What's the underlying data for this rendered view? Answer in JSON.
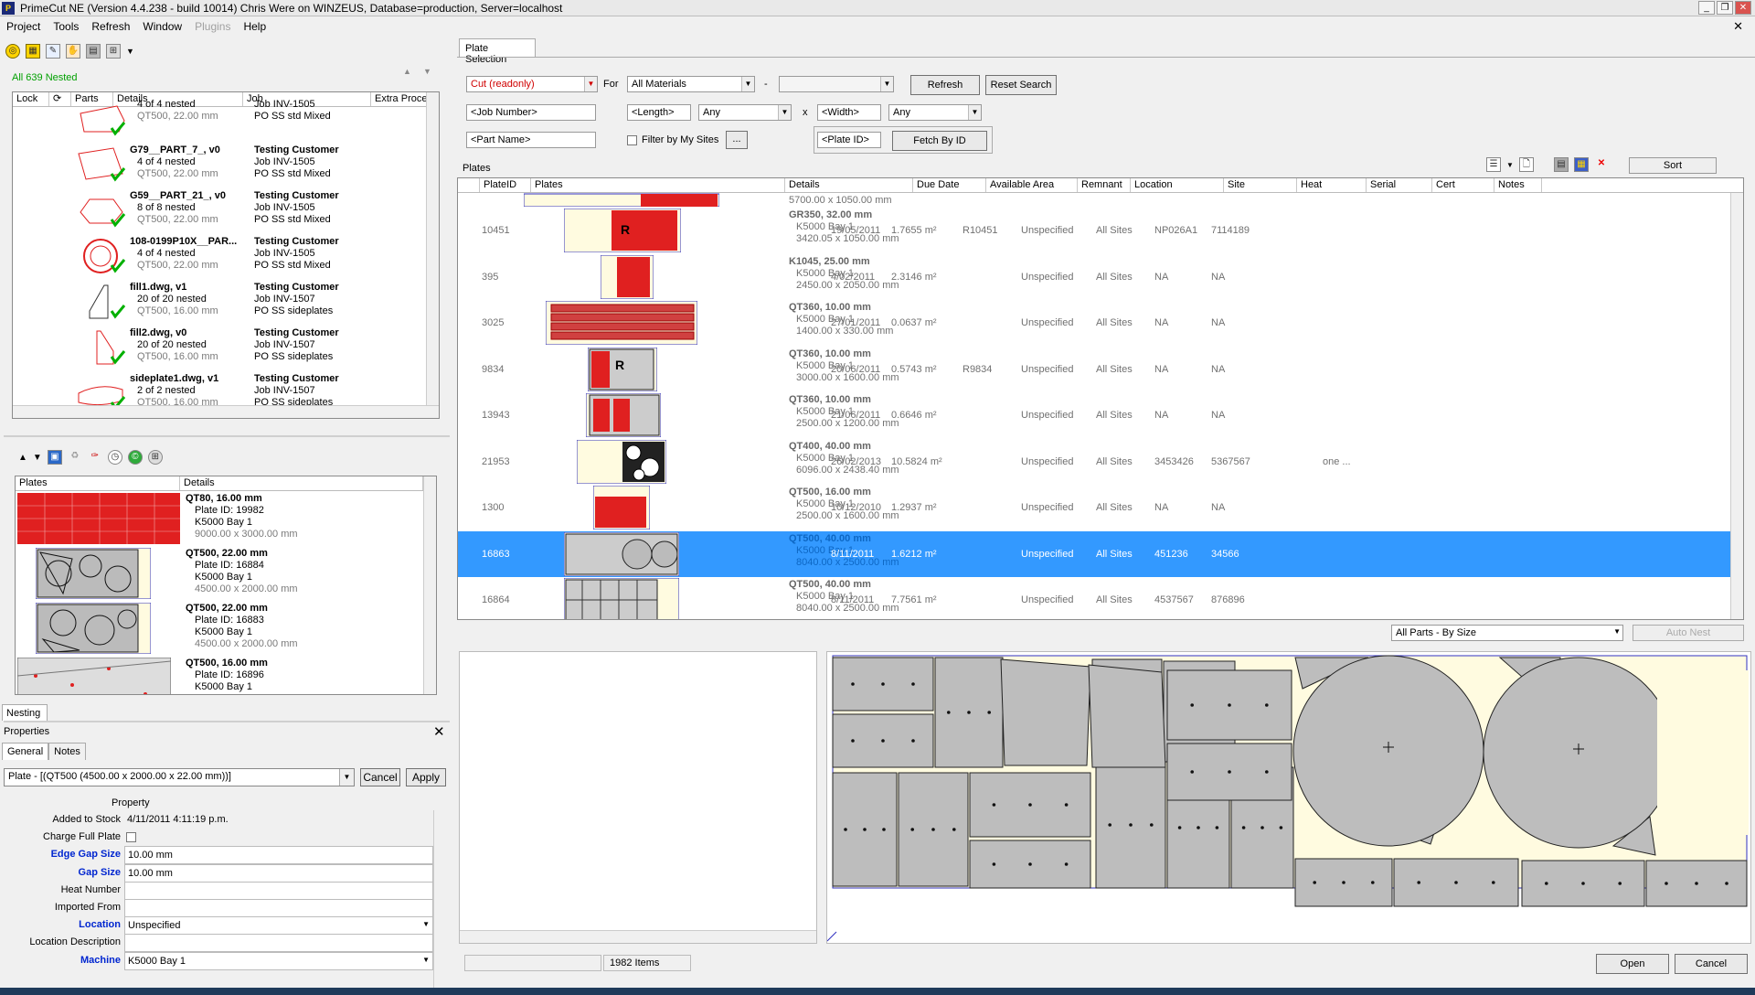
{
  "window": {
    "title": "PrimeCut NE (Version 4.4.238 - build 10014)  Chris Were on WINZEUS, Database=production, Server=localhost",
    "icon": "P",
    "controls": [
      "_",
      "❐",
      "✕"
    ]
  },
  "menu": {
    "items": [
      "Project",
      "Tools",
      "Refresh",
      "Window",
      "Plugins",
      "Help"
    ],
    "close": "✕"
  },
  "nested": {
    "summary": "All 639 Nested",
    "columns": [
      "Lock",
      "",
      "Parts",
      "Details",
      "Job",
      "Extra Proces"
    ],
    "rows": [
      {
        "name": "",
        "nested": "4 of 4 nested",
        "mat": "QT500, 22.00 mm",
        "customer": "",
        "job": "Job INV-1505",
        "po": "PO SS std Mixed"
      },
      {
        "name": "G79__PART_7_, v0",
        "nested": "4 of 4 nested",
        "mat": "QT500, 22.00 mm",
        "customer": "Testing Customer",
        "job": "Job INV-1505",
        "po": "PO SS std Mixed"
      },
      {
        "name": "G59__PART_21_, v0",
        "nested": "8 of 8 nested",
        "mat": "QT500, 22.00 mm",
        "customer": "Testing Customer",
        "job": "Job INV-1505",
        "po": "PO SS std Mixed"
      },
      {
        "name": "108-0199P10X__PAR...",
        "nested": "4 of 4 nested",
        "mat": "QT500, 22.00 mm",
        "customer": "Testing Customer",
        "job": "Job INV-1505",
        "po": "PO SS std Mixed"
      },
      {
        "name": "fill1.dwg, v1",
        "nested": "20 of 20 nested",
        "mat": "QT500, 16.00 mm",
        "customer": "Testing Customer",
        "job": "Job INV-1507",
        "po": "PO SS sideplates"
      },
      {
        "name": "fill2.dwg, v0",
        "nested": "20 of 20 nested",
        "mat": "QT500, 16.00 mm",
        "customer": "Testing Customer",
        "job": "Job INV-1507",
        "po": "PO SS sideplates"
      },
      {
        "name": "sideplate1.dwg, v1",
        "nested": "2 of 2 nested",
        "mat": "QT500, 16.00 mm",
        "customer": "Testing Customer",
        "job": "Job INV-1507",
        "po": "PO SS sideplates"
      }
    ]
  },
  "plates_panel": {
    "columns": [
      "Plates",
      "Details"
    ],
    "rows": [
      {
        "title": "QT80, 16.00 mm",
        "id": "Plate ID: 19982",
        "loc": "K5000 Bay 1",
        "size": "9000.00 x 3000.00 mm"
      },
      {
        "title": "QT500, 22.00 mm",
        "id": "Plate ID: 16884",
        "loc": "K5000 Bay 1",
        "size": "4500.00 x 2000.00 mm"
      },
      {
        "title": "QT500, 22.00 mm",
        "id": "Plate ID: 16883",
        "loc": "K5000 Bay 1",
        "size": "4500.00 x 2000.00 mm"
      },
      {
        "title": "QT500, 16.00 mm",
        "id": "Plate ID: 16896",
        "loc": "K5000 Bay 1",
        "size": ""
      }
    ]
  },
  "nesting_tab": "Nesting",
  "properties": {
    "header": "Properties",
    "tabs": [
      "General",
      "Notes"
    ],
    "selected": "Plate - [(QT500 (4500.00 x 2000.00 x 22.00 mm))]",
    "cancel": "Cancel",
    "apply": "Apply",
    "property_header": "Property",
    "fields": [
      {
        "label": "Added to Stock",
        "value": "4/11/2011 4:11:19 p.m.",
        "blue": false
      },
      {
        "label": "Charge Full Plate",
        "value": "",
        "blue": false
      },
      {
        "label": "Edge Gap Size",
        "value": "10.00 mm",
        "blue": true
      },
      {
        "label": "Gap Size",
        "value": "10.00 mm",
        "blue": true
      },
      {
        "label": "Heat Number",
        "value": "",
        "blue": false
      },
      {
        "label": "Imported From",
        "value": "",
        "blue": false
      },
      {
        "label": "Location",
        "value": "Unspecified",
        "blue": true
      },
      {
        "label": "Location Description",
        "value": "",
        "blue": false
      },
      {
        "label": "Machine",
        "value": "K5000 Bay 1",
        "blue": true
      }
    ]
  },
  "plate_selection": {
    "tab": "Plate Selection",
    "cut": "Cut (readonly)",
    "for": "For",
    "materials": "All Materials",
    "dash": "-",
    "refresh": "Refresh",
    "reset": "Reset Search",
    "job_number": "<Job Number>",
    "length": "<Length>",
    "any1": "Any",
    "x": "x",
    "width": "<Width>",
    "any2": "Any",
    "part_name": "<Part Name>",
    "filter_sites": "Filter by My Sites",
    "ellipsis": "...",
    "plate_id": "<Plate ID>",
    "fetch": "Fetch By ID",
    "plates_label": "Plates",
    "sort": "Sort"
  },
  "plates_table": {
    "columns": [
      "",
      "PlateID",
      "Plates",
      "Details",
      "Due Date",
      "Available Area",
      "Remnant",
      "Location",
      "Site",
      "Heat",
      "Serial",
      "Cert",
      "Notes"
    ],
    "partial_top": "5700.00 x 1050.00 mm",
    "rows": [
      {
        "id": "10451",
        "mat": "GR350, 32.00 mm",
        "bay": "K5000 Bay 1",
        "size": "3420.05 x 1050.00 mm",
        "due": "19/05/2011",
        "area": "1.7655 m²",
        "remnant": "R10451",
        "loc": "Unspecified",
        "site": "All Sites",
        "heat": "NP026A1",
        "serial": "7114189",
        "cert": "",
        "notes": ""
      },
      {
        "id": "395",
        "mat": "K1045, 25.00 mm",
        "bay": "K5000 Bay 1",
        "size": "2450.00 x 2050.00 mm",
        "due": "4/02/2011",
        "area": "2.3146 m²",
        "remnant": "",
        "loc": "Unspecified",
        "site": "All Sites",
        "heat": "NA",
        "serial": "NA",
        "cert": "",
        "notes": ""
      },
      {
        "id": "3025",
        "mat": "QT360, 10.00 mm",
        "bay": "K5000 Bay 1",
        "size": "1400.00 x 330.00 mm",
        "due": "27/01/2011",
        "area": "0.0637 m²",
        "remnant": "",
        "loc": "Unspecified",
        "site": "All Sites",
        "heat": "NA",
        "serial": "NA",
        "cert": "",
        "notes": ""
      },
      {
        "id": "9834",
        "mat": "QT360, 10.00 mm",
        "bay": "K5000 Bay 1",
        "size": "3000.00 x 1600.00 mm",
        "due": "20/06/2011",
        "area": "0.5743 m²",
        "remnant": "R9834",
        "loc": "Unspecified",
        "site": "All Sites",
        "heat": "NA",
        "serial": "NA",
        "cert": "",
        "notes": ""
      },
      {
        "id": "13943",
        "mat": "QT360, 10.00 mm",
        "bay": "K5000 Bay 1",
        "size": "2500.00 x 1200.00 mm",
        "due": "21/06/2011",
        "area": "0.6646 m²",
        "remnant": "",
        "loc": "Unspecified",
        "site": "All Sites",
        "heat": "NA",
        "serial": "NA",
        "cert": "",
        "notes": ""
      },
      {
        "id": "21953",
        "mat": "QT400, 40.00 mm",
        "bay": "K5000 Bay 1",
        "size": "6096.00 x 2438.40 mm",
        "due": "26/02/2013",
        "area": "10.5824 m²",
        "remnant": "",
        "loc": "Unspecified",
        "site": "All Sites",
        "heat": "3453426",
        "serial": "5367567",
        "cert": "",
        "notes": "one ..."
      },
      {
        "id": "1300",
        "mat": "QT500, 16.00 mm",
        "bay": "K5000 Bay 1",
        "size": "2500.00 x 1600.00 mm",
        "due": "10/12/2010",
        "area": "1.2937 m²",
        "remnant": "",
        "loc": "Unspecified",
        "site": "All Sites",
        "heat": "NA",
        "serial": "NA",
        "cert": "",
        "notes": ""
      },
      {
        "id": "16863",
        "mat": "QT500, 40.00 mm",
        "bay": "K5000 Bay 1",
        "size": "8040.00 x 2500.00 mm",
        "due": "8/11/2011",
        "area": "1.6212 m²",
        "remnant": "",
        "loc": "Unspecified",
        "site": "All Sites",
        "heat": "451236",
        "serial": "34566",
        "cert": "",
        "notes": ""
      },
      {
        "id": "16864",
        "mat": "QT500, 40.00 mm",
        "bay": "K5000 Bay 1",
        "size": "8040.00 x 2500.00 mm",
        "due": "8/11/2011",
        "area": "7.7561 m²",
        "remnant": "",
        "loc": "Unspecified",
        "site": "All Sites",
        "heat": "4537567",
        "serial": "876896",
        "cert": "",
        "notes": ""
      }
    ]
  },
  "bottom": {
    "parts_filter": "All Parts - By Size",
    "auto_nest": "Auto Nest",
    "items": "1982 Items",
    "open": "Open",
    "cancel": "Cancel"
  },
  "colors": {
    "selection": "#3399ff",
    "nested_green": "#00a000",
    "part_red": "#e02020",
    "plate_yellow": "#fffbe0",
    "part_gray": "#bdbdbd",
    "blue_label": "#0026d0"
  }
}
